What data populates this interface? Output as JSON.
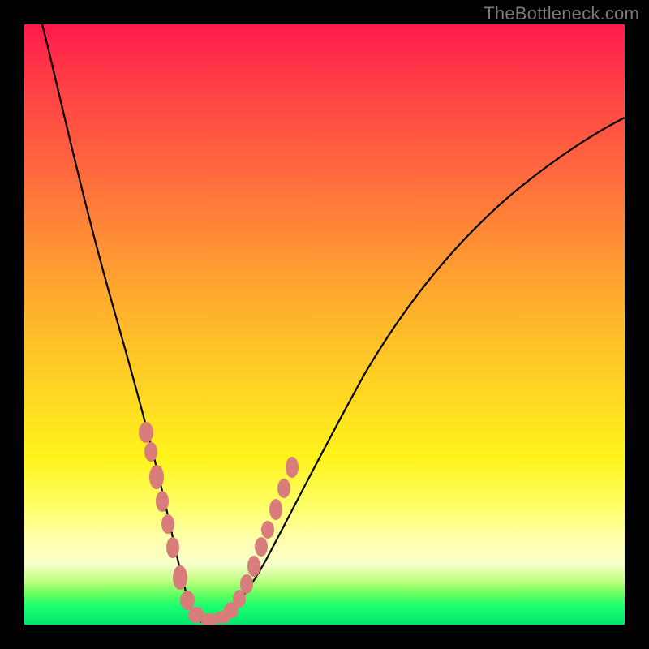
{
  "watermark": "TheBottleneck.com",
  "chart_data": {
    "type": "line",
    "title": "",
    "xlabel": "",
    "ylabel": "",
    "xlim": [
      0,
      100
    ],
    "ylim": [
      0,
      100
    ],
    "grid": false,
    "legend": false,
    "annotations": [],
    "colors": {
      "gradient_top": "#ff1a4b",
      "gradient_mid_high": "#ff9433",
      "gradient_mid": "#ffd823",
      "gradient_low": "#ffffb0",
      "gradient_bottom": "#00e66a",
      "curve": "#000000",
      "marker": "#d87c7c"
    },
    "series": [
      {
        "name": "bottleneck-curve",
        "type": "line",
        "x": [
          3,
          5,
          8,
          11,
          14,
          17,
          19,
          21,
          23,
          25,
          26.5,
          28,
          29.5,
          31,
          34,
          37,
          40,
          44,
          48,
          53,
          58,
          64,
          71,
          78,
          86,
          94,
          100
        ],
        "y": [
          100,
          90,
          78,
          67,
          56,
          45,
          37,
          30,
          23,
          16,
          11,
          6,
          3,
          1,
          1,
          4,
          8,
          13,
          19,
          26,
          33,
          41,
          49,
          57,
          65,
          73,
          78
        ]
      },
      {
        "name": "marker-cluster",
        "type": "scatter",
        "x": [
          20.5,
          21.5,
          22.8,
          23.8,
          24.6,
          25.6,
          27.0,
          28.2,
          29.4,
          30.8,
          32.4,
          33.2,
          34.0,
          35.2,
          36.2,
          37.4,
          38.6,
          40.0,
          41.2,
          42.6
        ],
        "y": [
          32,
          28,
          24,
          20,
          17,
          13,
          7,
          4,
          2,
          1,
          1,
          2,
          3,
          5,
          7,
          10,
          12,
          15,
          18,
          21
        ]
      }
    ]
  }
}
